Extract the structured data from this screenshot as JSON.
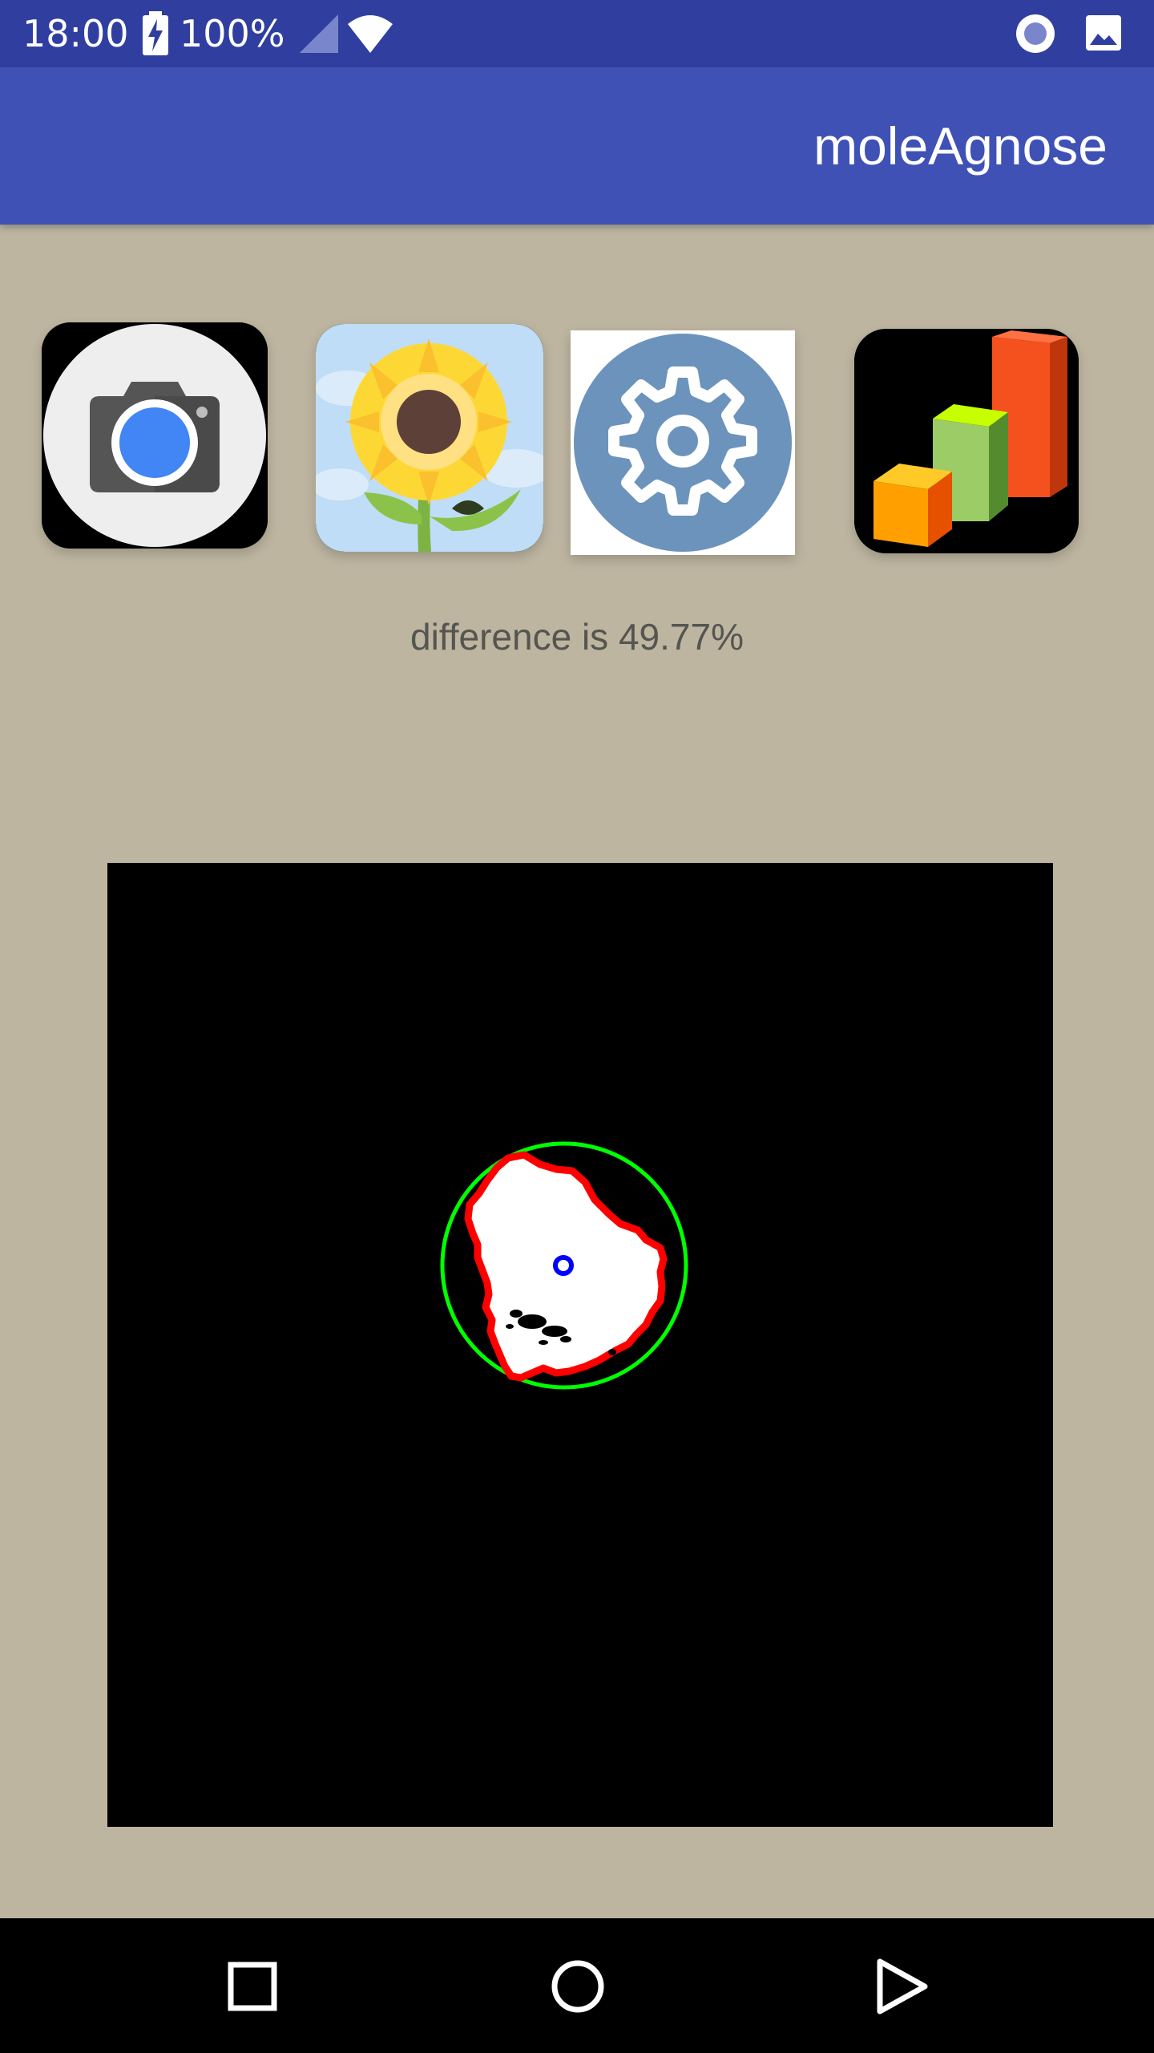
{
  "status_bar": {
    "time": "18:00",
    "battery_percent": "100%",
    "icons": [
      "battery-charging-icon",
      "cell-signal-icon",
      "wifi-icon",
      "screen-record-icon",
      "image-icon"
    ]
  },
  "app_bar": {
    "title": "moleAgnose"
  },
  "toolbar": {
    "buttons": [
      {
        "name": "camera-button",
        "icon": "camera-icon"
      },
      {
        "name": "gallery-button",
        "icon": "sunflower-gallery-icon"
      },
      {
        "name": "settings-button",
        "icon": "gear-icon"
      },
      {
        "name": "chart-button",
        "icon": "bar-chart-icon"
      }
    ]
  },
  "result": {
    "text": "difference is 49.77%"
  },
  "analysis_image": {
    "background": "#000000",
    "lesion_fill": "#FFFFFF",
    "contour_color": "#FF0000",
    "enclosing_circle_color": "#00FF00",
    "centroid_color": "#0000FF"
  },
  "nav_bar": {
    "buttons": [
      "recents-button",
      "home-button",
      "back-button"
    ]
  },
  "colors": {
    "status_bar": "#303F9F",
    "app_bar": "#3F51B5",
    "background": "#BDB5A0",
    "nav_bar": "#000000"
  }
}
